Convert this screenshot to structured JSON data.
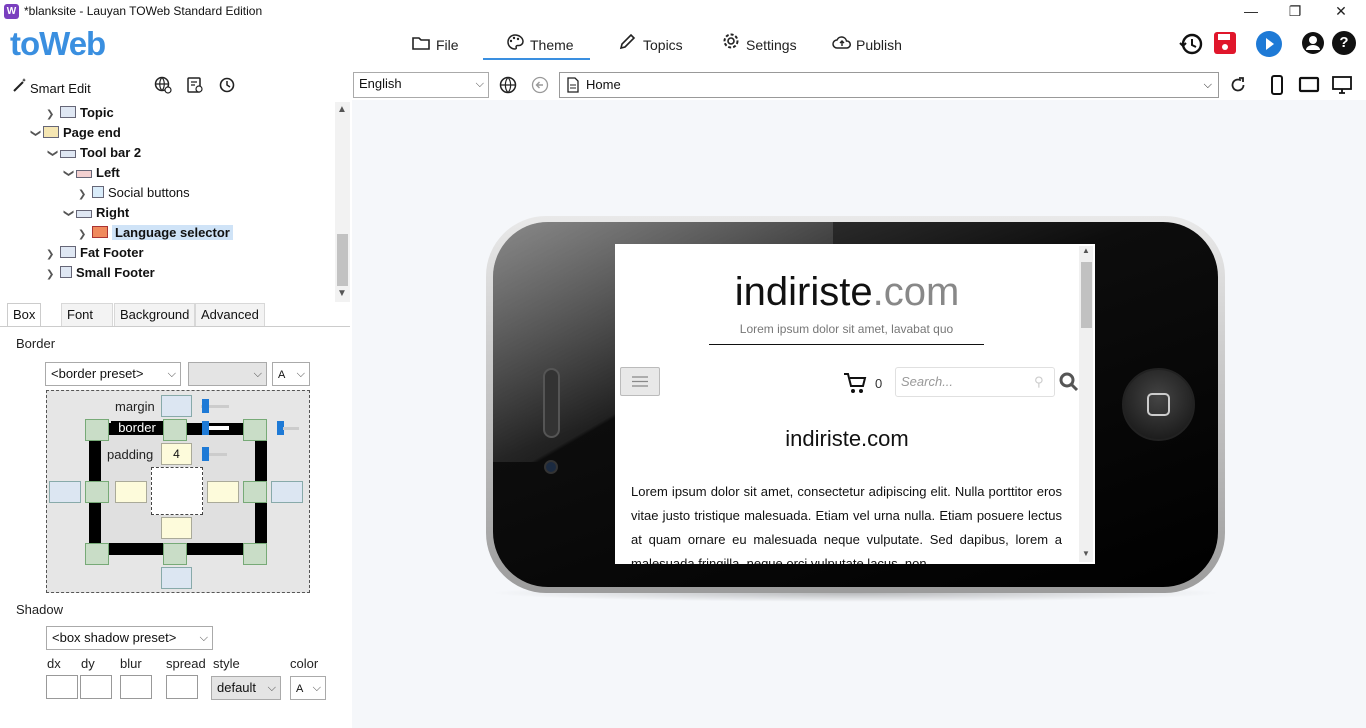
{
  "window": {
    "title": "*blanksite - Lauyan TOWeb Standard Edition",
    "app_icon_letter": "W",
    "minimize": "—",
    "restore": "❐",
    "close": "✕"
  },
  "logo": "toWeb",
  "menu": {
    "file": "File",
    "theme": "Theme",
    "topics": "Topics",
    "settings": "Settings",
    "publish": "Publish"
  },
  "toolbar_right": {
    "history_icon": "history-icon",
    "save_icon": "save-icon",
    "play_icon": "play-icon",
    "account_icon": "account-icon",
    "help": "?"
  },
  "smart_edit": {
    "label": "Smart Edit"
  },
  "tree": {
    "items": [
      {
        "label": "Topic",
        "level": 1,
        "state": "collapsed"
      },
      {
        "label": "Page end",
        "level": 0,
        "state": "expanded"
      },
      {
        "label": "Tool bar 2",
        "level": 1,
        "state": "expanded"
      },
      {
        "label": "Left",
        "level": 2,
        "state": "expanded"
      },
      {
        "label": "Social buttons",
        "level": 3,
        "state": "collapsed"
      },
      {
        "label": "Right",
        "level": 2,
        "state": "expanded"
      },
      {
        "label": "Language selector",
        "level": 3,
        "state": "collapsed",
        "selected": true
      },
      {
        "label": "Fat Footer",
        "level": 1,
        "state": "collapsed"
      },
      {
        "label": "Small Footer",
        "level": 1,
        "state": "collapsed"
      }
    ]
  },
  "tabs": {
    "box": "Box",
    "font": "Font",
    "background": "Background",
    "advanced": "Advanced"
  },
  "border_section": {
    "label": "Border",
    "preset": "<border preset>",
    "color_value": "A",
    "margin_label": "margin",
    "border_label": "border",
    "padding_label": "padding",
    "padding_value": "4"
  },
  "shadow_section": {
    "label": "Shadow",
    "preset": "<box shadow preset>",
    "dx": "dx",
    "dy": "dy",
    "blur": "blur",
    "spread": "spread",
    "style": "style",
    "color": "color",
    "style_value": "default",
    "color_value": "A"
  },
  "address": {
    "language": "English",
    "page": "Home"
  },
  "site": {
    "title_main": "indiriste",
    "title_tld": ".com",
    "tagline": "Lorem ipsum dolor sit amet, lavabat quo",
    "cart_count": "0",
    "search_placeholder": "Search...",
    "heading": "indiriste.com",
    "body": "Lorem ipsum dolor sit amet, consectetur adipiscing elit. Nulla porttitor eros vitae justo tristique malesuada. Etiam vel urna nulla. Etiam posuere lectus at quam ornare eu malesuada neque vulputate. Sed dapibus, lorem a malesuada fringilla, neque orci vulputate lacus, non"
  },
  "colors": {
    "accent": "#3a8fe0",
    "save": "#e0162b",
    "play": "#1e7ad6"
  }
}
